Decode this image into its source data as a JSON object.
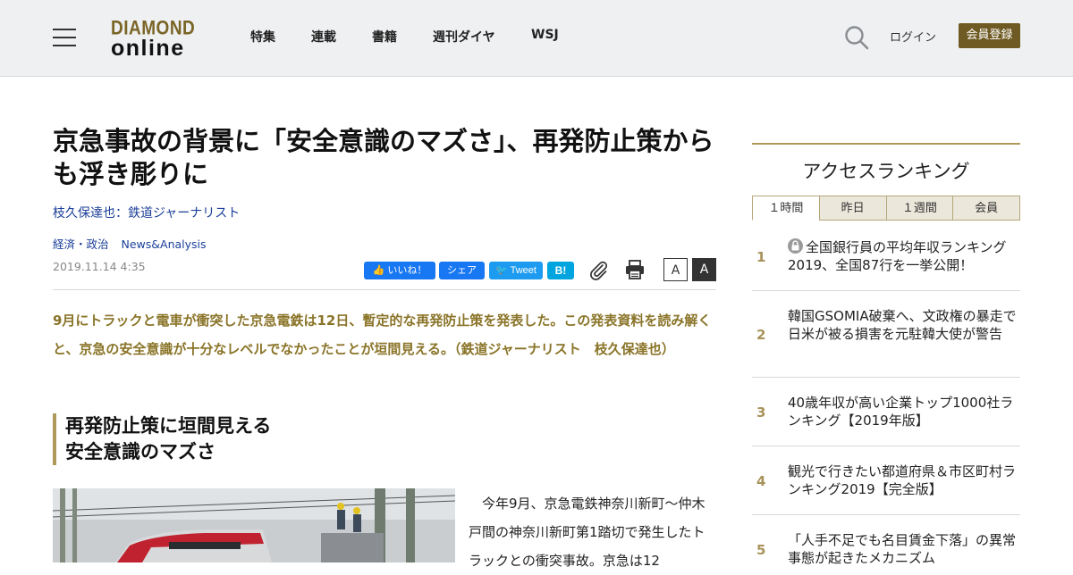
{
  "header": {
    "logo_top": "DIAMOND",
    "logo_bottom": "online",
    "nav": [
      "特集",
      "連載",
      "書籍",
      "週刊ダイヤ",
      "WSJ"
    ],
    "login": "ログイン",
    "register": "会員登録"
  },
  "article": {
    "title": "京急事故の背景に「安全意識のマズさ」、再発防止策からも浮き彫りに",
    "author": "枝久保達也：鉄道ジャーナリスト",
    "tags": [
      "経済・政治",
      "News&Analysis"
    ],
    "date": "2019.11.14 4:35",
    "share": {
      "like": "いいね！",
      "share": "シェア",
      "tweet": "Tweet",
      "hatena": "B!",
      "font_small": "A",
      "font_large": "A"
    },
    "lead": "9月にトラックと電車が衝突した京急電鉄は12日、暫定的な再発防止策を発表した。この発表資料を読み解くと、京急の安全意識が十分なレベルでなかったことが垣間見える。（鉄道ジャーナリスト　枝久保達也）",
    "subheading": "再発防止策に垣間見える\n安全意識のマズさ",
    "body": "今年9月、京急電鉄神奈川新町～仲木戸間の神奈川新町第1踏切で発生したトラックとの衝突事故。京急は12"
  },
  "ranking": {
    "title": "アクセスランキング",
    "tabs": [
      "１時間",
      "昨日",
      "１週間",
      "会員"
    ],
    "items": [
      {
        "rank": "1",
        "title": "全国銀行員の平均年収ランキング2019、全国87行を一挙公開！"
      },
      {
        "rank": "2",
        "title": "韓国GSOMIA破棄へ、文政権の暴走で日米が被る損害を元駐韓大使が警告"
      },
      {
        "rank": "3",
        "title": "40歳年収が高い企業トップ1000社ランキング【2019年版】"
      },
      {
        "rank": "4",
        "title": "観光で行きたい都道府県＆市区町村ランキング2019【完全版】"
      },
      {
        "rank": "5",
        "title": "「人手不足でも名目賃金下落」の異常事態が起きたメカニズム"
      }
    ]
  },
  "colors": {
    "brand_gold": "#7a6526",
    "register_bg": "#6e5a22",
    "lead_text": "#8a7428",
    "link_blue": "#1b3f99",
    "facebook": "#1877f2",
    "twitter": "#1d9bf0",
    "hatena": "#00a4de"
  }
}
